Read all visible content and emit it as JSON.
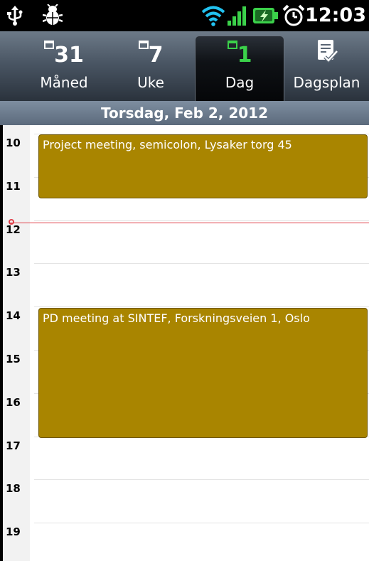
{
  "status_bar": {
    "time": "12:03",
    "icons": [
      "usb-icon",
      "debug-bug-icon",
      "wifi-icon",
      "signal-icon",
      "battery-charging-icon",
      "alarm-icon"
    ]
  },
  "tabs": [
    {
      "label": "Måned",
      "icon_number": "31",
      "selected": false
    },
    {
      "label": "Uke",
      "icon_number": "7",
      "selected": false
    },
    {
      "label": "Dag",
      "icon_number": "1",
      "selected": true
    },
    {
      "label": "Dagsplan",
      "icon": "agenda-list-icon",
      "selected": false
    }
  ],
  "date_header": "Torsdag, Feb 2, 2012",
  "hours": [
    "10",
    "11",
    "12",
    "13",
    "14",
    "15",
    "16",
    "17",
    "18",
    "19"
  ],
  "events": [
    {
      "title": "Project meeting, semicolon, Lysaker torg 45",
      "start": "10:00",
      "end": "11:30"
    },
    {
      "title": "PD meeting at SINTEF, Forskningsveien 1, Oslo",
      "start": "14:00",
      "end": "17:00"
    }
  ],
  "colors": {
    "event": "#a98500",
    "now_line": "#e0404a",
    "selected_tab_icon": "#3bd14a"
  }
}
